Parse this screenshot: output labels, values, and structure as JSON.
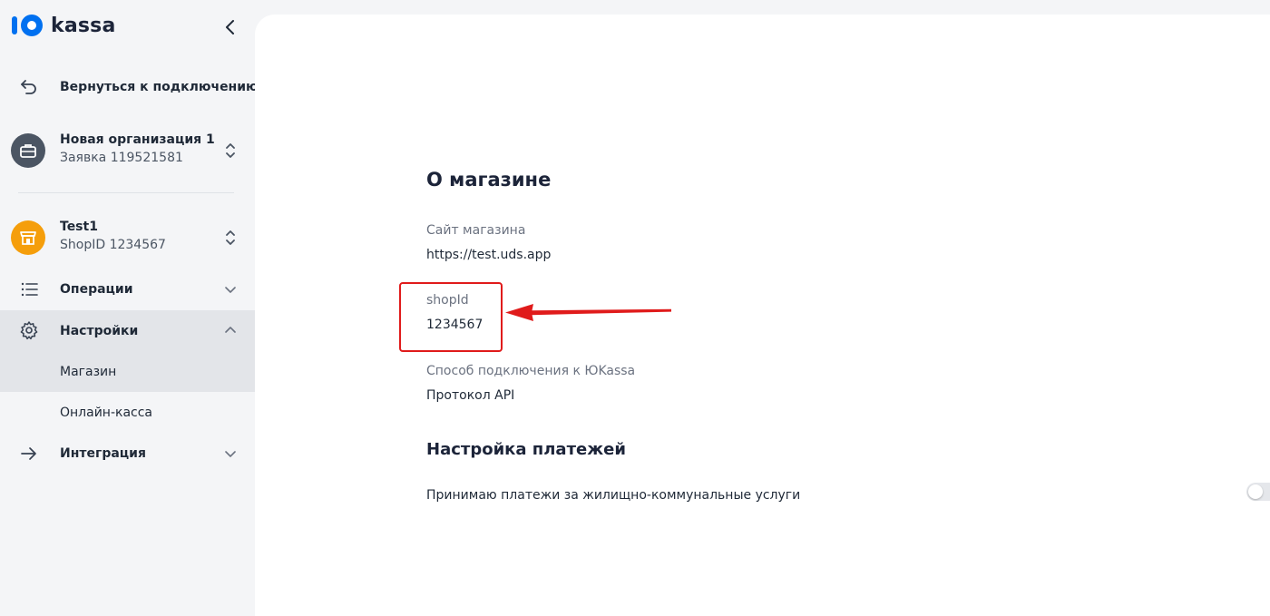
{
  "brand": {
    "logo_text": "kassa",
    "logo_color": "#1c2439"
  },
  "sidebar": {
    "back_label": "Вернуться к подключению",
    "org": {
      "title": "Новая организация 1",
      "subtitle": "Заявка 119521581"
    },
    "shop": {
      "title": "Test1",
      "subtitle": "ShopID 1234567"
    },
    "nav": {
      "operations": "Операции",
      "settings": "Настройки",
      "settings_sub": [
        "Магазин",
        "Онлайн-касса"
      ],
      "integration": "Интеграция"
    }
  },
  "main": {
    "section_title": "О магазине",
    "fields": [
      {
        "label": "Сайт магазина",
        "value": "https://test.uds.app"
      },
      {
        "label": "shopId",
        "value": "1234567"
      },
      {
        "label": "Способ подключения к ЮKassa",
        "value": "Протокол API"
      }
    ],
    "payments_title": "Настройка платежей",
    "payments_option": {
      "label": "Принимаю платежи за жилищно-коммунальные услуги",
      "enabled": false
    }
  },
  "colors": {
    "accent_orange": "#f59e0b",
    "avatar_dark": "#4b5563",
    "annotation_red": "#e01b1b"
  }
}
